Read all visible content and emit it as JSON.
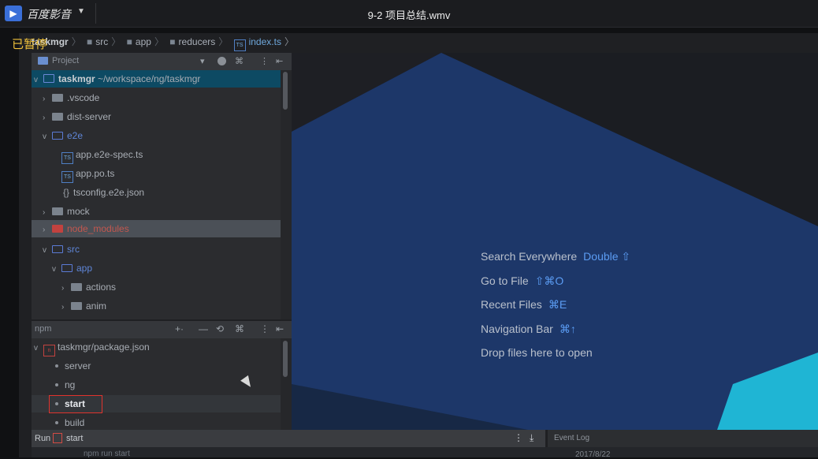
{
  "player": {
    "app_name": "百度影音",
    "video_title": "9-2 项目总结.wmv",
    "paused_label": "已暂停"
  },
  "ide": {
    "breadcrumb": [
      "taskmgr",
      "src",
      "app",
      "reducers",
      "index.ts"
    ],
    "project_panel": {
      "title": "Project",
      "items": [
        {
          "label": "taskmgr",
          "suffix": " ~/workspace/ng/taskmgr"
        },
        {
          "label": ".vscode"
        },
        {
          "label": "dist-server"
        },
        {
          "label": "e2e"
        },
        {
          "label": "app.e2e-spec.ts",
          "badge": "TS"
        },
        {
          "label": "app.po.ts",
          "badge": "TS"
        },
        {
          "label": "tsconfig.e2e.json",
          "badge": "{}"
        },
        {
          "label": "mock"
        },
        {
          "label": "node_modules"
        },
        {
          "label": "src"
        },
        {
          "label": "app"
        },
        {
          "label": "actions"
        },
        {
          "label": "anim"
        }
      ]
    },
    "npm_panel": {
      "title": "npm",
      "package": "taskmgr/package.json",
      "scripts": [
        "server",
        "ng",
        "start",
        "build"
      ],
      "selected": "start"
    },
    "editor_hints": [
      {
        "label": "Search Everywhere",
        "key": "Double ⇧"
      },
      {
        "label": "Go to File",
        "key": "⇧⌘O"
      },
      {
        "label": "Recent Files",
        "key": "⌘E"
      },
      {
        "label": "Navigation Bar",
        "key": "⌘↑"
      },
      {
        "label": "Drop files here to open",
        "key": ""
      }
    ],
    "run_bar": {
      "label": "Run",
      "config": "start",
      "command": "npm run start"
    },
    "event_log": {
      "title": "Event Log",
      "date": "2017/8/22"
    }
  },
  "colors": {
    "accent": "#5b9cf3",
    "selection": "#0d4a63",
    "paused": "#f0c23c",
    "highlight_box": "#e0332d"
  }
}
